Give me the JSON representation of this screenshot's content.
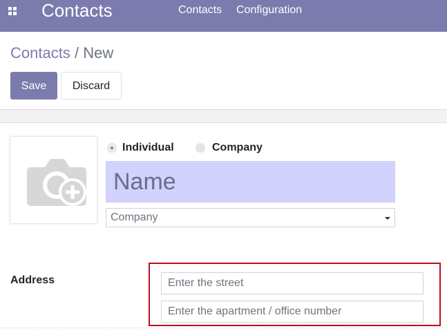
{
  "header": {
    "app_title": "Contacts",
    "menu": [
      "Contacts",
      "Configuration"
    ],
    "icon": "apps-grid-icon"
  },
  "breadcrumb": {
    "parent": "Contacts",
    "separator": "/",
    "current": "New"
  },
  "toolbar": {
    "save_label": "Save",
    "discard_label": "Discard"
  },
  "form": {
    "avatar_icon": "camera-plus-icon",
    "type_options": [
      {
        "label": "Individual",
        "checked": true
      },
      {
        "label": "Company",
        "checked": false
      }
    ],
    "name_placeholder": "Name",
    "company_placeholder": "Company",
    "address_label": "Address",
    "street_placeholder": "Enter the street",
    "street2_placeholder": "Enter the apartment / office number"
  },
  "colors": {
    "brand": "#7c7bad",
    "name_field_bg": "#d2d2ff",
    "highlight_border": "#b80d1d"
  }
}
